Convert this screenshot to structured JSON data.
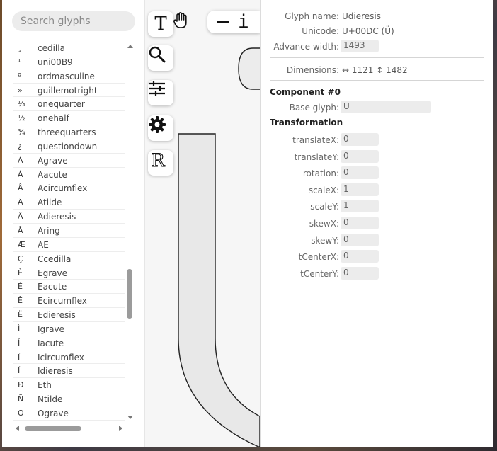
{
  "search": {
    "placeholder": "Search glyphs"
  },
  "glyph_list": [
    {
      "char": "¸",
      "name": "cedilla"
    },
    {
      "char": "¹",
      "name": "uni00B9"
    },
    {
      "char": "º",
      "name": "ordmasculine"
    },
    {
      "char": "»",
      "name": "guillemotright"
    },
    {
      "char": "¼",
      "name": "onequarter"
    },
    {
      "char": "½",
      "name": "onehalf"
    },
    {
      "char": "¾",
      "name": "threequarters"
    },
    {
      "char": "¿",
      "name": "questiondown"
    },
    {
      "char": "À",
      "name": "Agrave"
    },
    {
      "char": "Á",
      "name": "Aacute"
    },
    {
      "char": "Â",
      "name": "Acircumflex"
    },
    {
      "char": "Ã",
      "name": "Atilde"
    },
    {
      "char": "Ä",
      "name": "Adieresis"
    },
    {
      "char": "Å",
      "name": "Aring"
    },
    {
      "char": "Æ",
      "name": "AE"
    },
    {
      "char": "Ç",
      "name": "Ccedilla"
    },
    {
      "char": "È",
      "name": "Egrave"
    },
    {
      "char": "É",
      "name": "Eacute"
    },
    {
      "char": "Ê",
      "name": "Ecircumflex"
    },
    {
      "char": "Ë",
      "name": "Edieresis"
    },
    {
      "char": "Ì",
      "name": "Igrave"
    },
    {
      "char": "Í",
      "name": "Iacute"
    },
    {
      "char": "Î",
      "name": "Icircumflex"
    },
    {
      "char": "Ï",
      "name": "Idieresis"
    },
    {
      "char": "Ð",
      "name": "Eth"
    },
    {
      "char": "Ñ",
      "name": "Ntilde"
    },
    {
      "char": "Ò",
      "name": "Ograve"
    }
  ],
  "toolbar": {
    "text_tool_glyph": "T",
    "info_glyph": "i",
    "reference_glyph": "R"
  },
  "info": {
    "glyph_name_label": "Glyph name:",
    "glyph_name_value": "Udieresis",
    "unicode_label": "Unicode:",
    "unicode_value": "U+00DC (Ü)",
    "advance_width_label": "Advance width:",
    "advance_width_value": "1493",
    "dimensions_label": "Dimensions:",
    "dimensions_value": "↔ 1121 ↕ 1482",
    "component_heading": "Component #0",
    "base_glyph_label": "Base glyph:",
    "base_glyph_value": "U",
    "transformation_heading": "Transformation",
    "transform": [
      {
        "label": "translateX:",
        "value": "0"
      },
      {
        "label": "translateY:",
        "value": "0"
      },
      {
        "label": "rotation:",
        "value": "0"
      },
      {
        "label": "scaleX:",
        "value": "1"
      },
      {
        "label": "scaleY:",
        "value": "1"
      },
      {
        "label": "skewX:",
        "value": "0"
      },
      {
        "label": "skewY:",
        "value": "0"
      },
      {
        "label": "tCenterX:",
        "value": "0"
      },
      {
        "label": "tCenterY:",
        "value": "0"
      }
    ]
  },
  "colors": {
    "panel_bg": "#ffffff",
    "canvas_bg": "#f6f6f6",
    "glyph_fill": "#e8e8e8",
    "glyph_stroke": "#222222"
  }
}
